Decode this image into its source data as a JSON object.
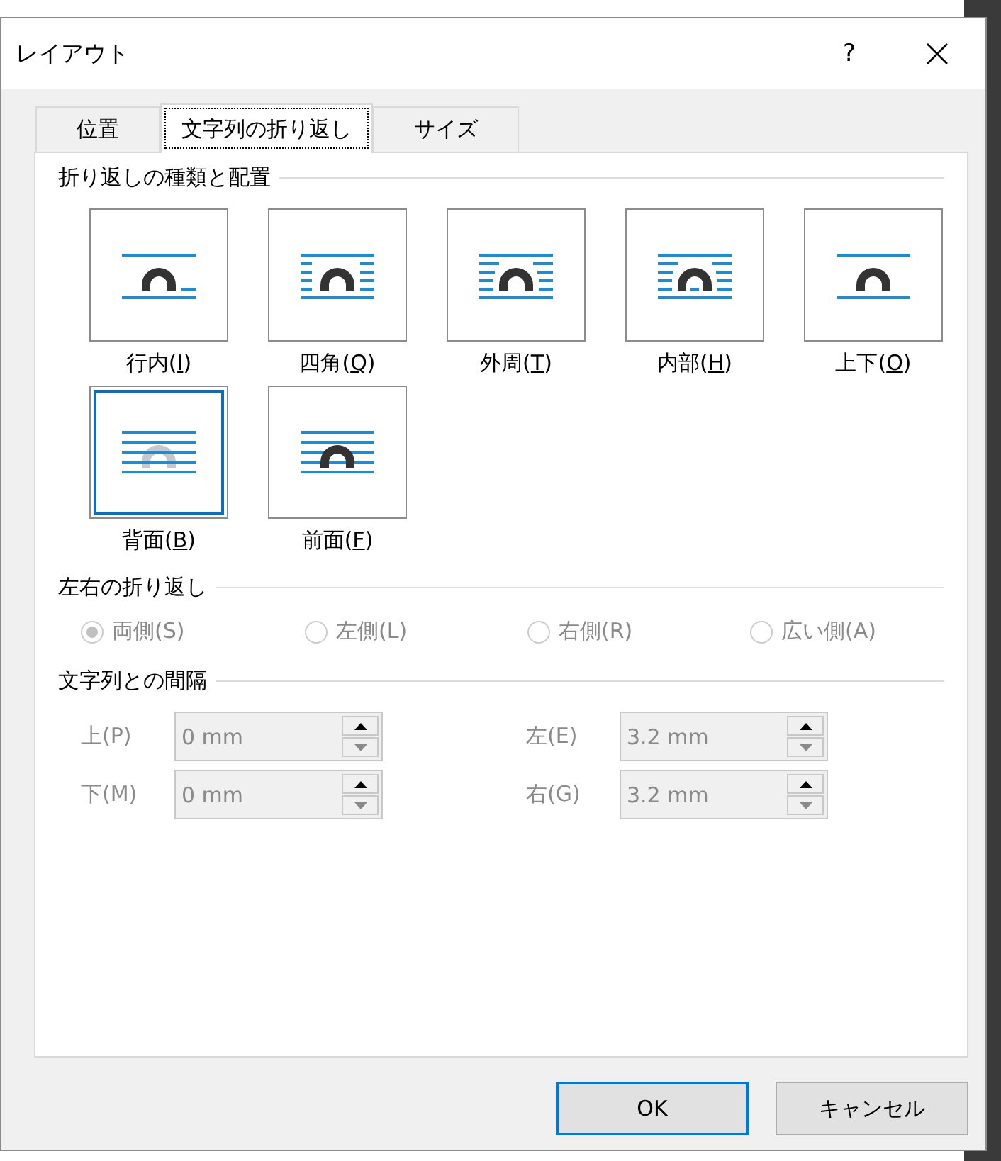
{
  "window": {
    "title": "レイアウト",
    "help": "?"
  },
  "tabs": [
    {
      "label": "位置",
      "selected": false
    },
    {
      "label": "文字列の折り返し",
      "selected": true
    },
    {
      "label": "サイズ",
      "selected": false
    }
  ],
  "wrap_style": {
    "heading": "折り返しの種類と配置",
    "options": [
      {
        "kind": "inline",
        "label": "行内(",
        "key": "I",
        "tail": ")",
        "selected": false
      },
      {
        "kind": "square",
        "label": "四角(",
        "key": "Q",
        "tail": ")",
        "selected": false
      },
      {
        "kind": "tight",
        "label": "外周(",
        "key": "T",
        "tail": ")",
        "selected": false
      },
      {
        "kind": "through",
        "label": "内部(",
        "key": "H",
        "tail": ")",
        "selected": false
      },
      {
        "kind": "topbottom",
        "label": "上下(",
        "key": "O",
        "tail": ")",
        "selected": false
      },
      {
        "kind": "behind",
        "label": "背面(",
        "key": "B",
        "tail": ")",
        "selected": true
      },
      {
        "kind": "front",
        "label": "前面(",
        "key": "F",
        "tail": ")",
        "selected": false
      }
    ]
  },
  "wrap_text": {
    "heading": "左右の折り返し",
    "disabled": true,
    "options": [
      {
        "label": "両側(S)",
        "selected": true
      },
      {
        "label": "左側(L)",
        "selected": false
      },
      {
        "label": "右側(R)",
        "selected": false
      },
      {
        "label": "広い側(A)",
        "selected": false
      }
    ]
  },
  "distance": {
    "heading": "文字列との間隔",
    "disabled": true,
    "fields": [
      {
        "label": "上(P)",
        "value": "0 mm"
      },
      {
        "label": "左(E)",
        "value": "3.2 mm"
      },
      {
        "label": "下(M)",
        "value": "0 mm"
      },
      {
        "label": "右(G)",
        "value": "3.2 mm"
      }
    ]
  },
  "buttons": [
    {
      "label": "OK",
      "default": true
    },
    {
      "label": "キャンセル",
      "default": false
    }
  ]
}
